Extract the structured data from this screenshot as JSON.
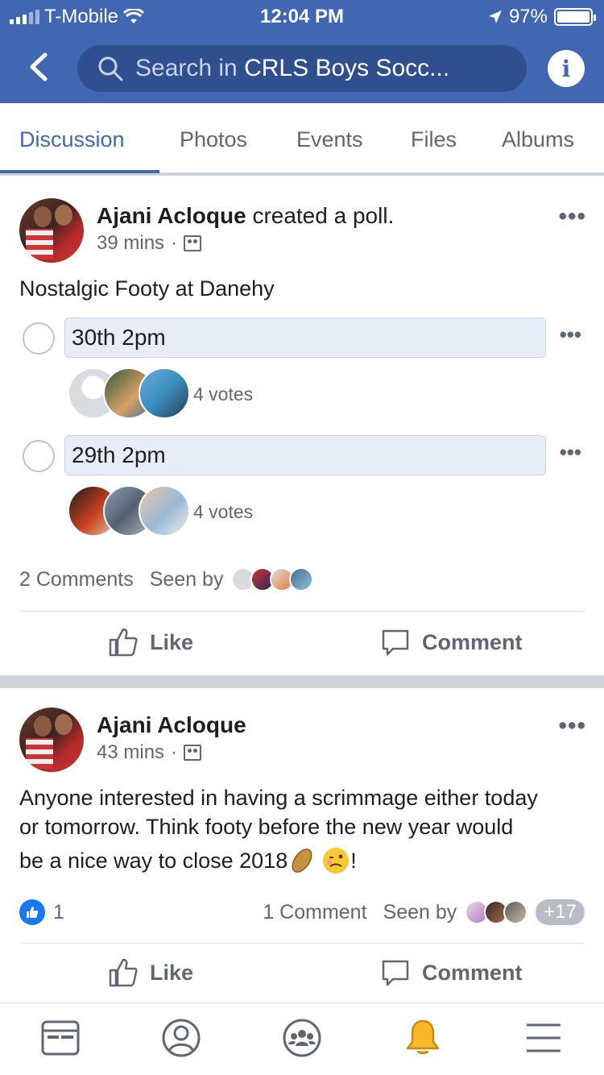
{
  "status_bar": {
    "carrier": "T-Mobile",
    "time": "12:04 PM",
    "battery": "97%"
  },
  "header": {
    "search_placeholder": "Search in",
    "group_name": "CRLS Boys Socc..."
  },
  "tabs": [
    {
      "label": "Discussion",
      "active": true
    },
    {
      "label": "Photos"
    },
    {
      "label": "Events"
    },
    {
      "label": "Files"
    },
    {
      "label": "Albums"
    }
  ],
  "post1": {
    "author": "Ajani Acloque",
    "action": "created a poll.",
    "time": "39 mins",
    "question": "Nostalgic Footy at Danehy",
    "options": [
      {
        "label": "30th 2pm",
        "votes": "4 votes"
      },
      {
        "label": "29th 2pm",
        "votes": "4 votes"
      }
    ],
    "comments": "2 Comments",
    "seen_by": "Seen by",
    "like_label": "Like",
    "comment_label": "Comment"
  },
  "post2": {
    "author": "Ajani Acloque",
    "time": "43 mins",
    "text_line1": "Anyone interested in having a scrimmage either today",
    "text_line2": "or tomorrow. Think footy before the new year would",
    "text_line3": "be a nice way to close 2018",
    "text_end": "!",
    "like_count": "1",
    "comments": "1 Comment",
    "seen_by": "Seen by",
    "seen_more": "+17",
    "like_label": "Like",
    "comment_label": "Comment"
  },
  "colors": {
    "brand": "#4267b2",
    "notification_active": "#f7b928"
  }
}
